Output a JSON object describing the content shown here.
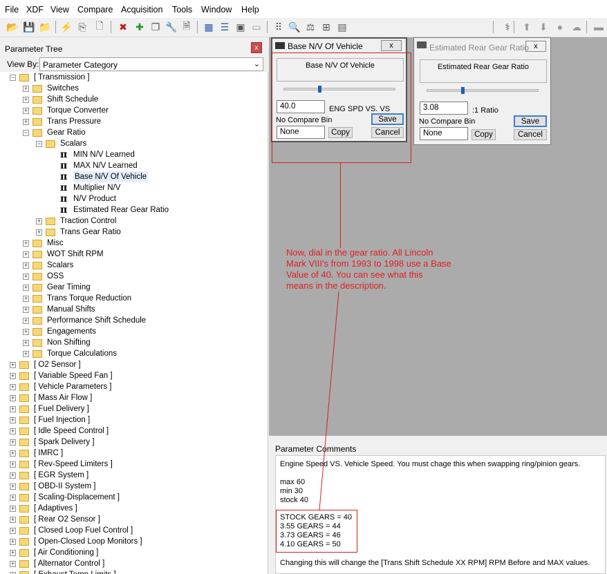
{
  "menu": [
    "File",
    "XDF",
    "View",
    "Compare",
    "Acquisition",
    "Tools",
    "Window",
    "Help"
  ],
  "toolbar": {
    "icons": [
      "open-icon",
      "save-icon",
      "open-folder-icon",
      "flash-icon",
      "copy-icon",
      "new-icon",
      "delete-icon",
      "add-icon",
      "duplicate-icon",
      "wrench-icon",
      "document-icon",
      "table-view-icon",
      "list-view-icon",
      "calendar-icon",
      "monitor-icon",
      "binary-icon",
      "search-icon",
      "balance-icon",
      "hierarchy-icon",
      "calculator-icon",
      "probe-icon",
      "up-arrow-icon",
      "down-arrow-icon",
      "record-icon",
      "cloud-icon",
      "chip-icon"
    ]
  },
  "parameter_tree": {
    "title": "Parameter Tree",
    "close": "x",
    "view_by_label": "View By:",
    "view_by_value": "Parameter Category",
    "nodes": [
      {
        "label": "[ Transmission ]",
        "level": 0,
        "expanded": true,
        "icon": "folder"
      },
      {
        "label": "Switches",
        "level": 1,
        "icon": "folder"
      },
      {
        "label": "Shift Schedule",
        "level": 1,
        "icon": "folder"
      },
      {
        "label": "Torque Converter",
        "level": 1,
        "icon": "folder"
      },
      {
        "label": "Trans Pressure",
        "level": 1,
        "icon": "folder"
      },
      {
        "label": "Gear Ratio",
        "level": 1,
        "expanded": true,
        "icon": "folder"
      },
      {
        "label": "Scalars",
        "level": 2,
        "expanded": true,
        "icon": "folder"
      },
      {
        "label": "MIN N/V Learned",
        "level": 3,
        "icon": "pi"
      },
      {
        "label": "MAX N/V Learned",
        "level": 3,
        "icon": "pi"
      },
      {
        "label": "Base N/V Of Vehicle",
        "level": 3,
        "icon": "pi",
        "selected": true
      },
      {
        "label": "Multiplier N/V",
        "level": 3,
        "icon": "pi"
      },
      {
        "label": "N/V Product",
        "level": 3,
        "icon": "pi"
      },
      {
        "label": "Estimated Rear Gear Ratio",
        "level": 3,
        "icon": "pi"
      },
      {
        "label": "Traction Control",
        "level": 2,
        "icon": "folder"
      },
      {
        "label": "Trans Gear Ratio",
        "level": 2,
        "icon": "folder"
      },
      {
        "label": "Misc",
        "level": 1,
        "icon": "folder"
      },
      {
        "label": "WOT Shift RPM",
        "level": 1,
        "icon": "folder"
      },
      {
        "label": "Scalars",
        "level": 1,
        "icon": "folder"
      },
      {
        "label": "OSS",
        "level": 1,
        "icon": "folder"
      },
      {
        "label": "Gear Timing",
        "level": 1,
        "icon": "folder"
      },
      {
        "label": "Trans Torque Reduction",
        "level": 1,
        "icon": "folder"
      },
      {
        "label": "Manual Shifts",
        "level": 1,
        "icon": "folder"
      },
      {
        "label": "Performance Shift Schedule",
        "level": 1,
        "icon": "folder"
      },
      {
        "label": "Engagements",
        "level": 1,
        "icon": "folder"
      },
      {
        "label": "Non Shifting",
        "level": 1,
        "icon": "folder"
      },
      {
        "label": "Torque Calculations",
        "level": 1,
        "icon": "folder"
      },
      {
        "label": "[ O2 Sensor ]",
        "level": 0,
        "icon": "folder"
      },
      {
        "label": "[ Variable Speed Fan ]",
        "level": 0,
        "icon": "folder"
      },
      {
        "label": "[ Vehicle Parameters ]",
        "level": 0,
        "icon": "folder"
      },
      {
        "label": "[ Mass Air Flow ]",
        "level": 0,
        "icon": "folder"
      },
      {
        "label": "[ Fuel Delivery ]",
        "level": 0,
        "icon": "folder"
      },
      {
        "label": "[ Fuel Injection ]",
        "level": 0,
        "icon": "folder"
      },
      {
        "label": "[ Idle Speed Control ]",
        "level": 0,
        "icon": "folder"
      },
      {
        "label": "[ Spark Delivery ]",
        "level": 0,
        "icon": "folder"
      },
      {
        "label": "[ IMRC ]",
        "level": 0,
        "icon": "folder"
      },
      {
        "label": "[ Rev-Speed Limiters ]",
        "level": 0,
        "icon": "folder"
      },
      {
        "label": "[ EGR System ]",
        "level": 0,
        "icon": "folder"
      },
      {
        "label": "[ OBD-II System ]",
        "level": 0,
        "icon": "folder"
      },
      {
        "label": "[ Scaling-Displacement ]",
        "level": 0,
        "icon": "folder"
      },
      {
        "label": "[ Adaptives ]",
        "level": 0,
        "icon": "folder"
      },
      {
        "label": "[ Rear O2 Sensor ]",
        "level": 0,
        "icon": "folder"
      },
      {
        "label": "[ Closed Loop Fuel Control ]",
        "level": 0,
        "icon": "folder"
      },
      {
        "label": "[ Open-Closed Loop Monitors ]",
        "level": 0,
        "icon": "folder"
      },
      {
        "label": "[ Air Conditioning ]",
        "level": 0,
        "icon": "folder"
      },
      {
        "label": "[ Alternator Control ]",
        "level": 0,
        "icon": "folder"
      },
      {
        "label": "[ Exhaust Temp Limits ]",
        "level": 0,
        "icon": "folder"
      }
    ]
  },
  "window_base": {
    "title": "Base N/V Of Vehicle",
    "description": "Base N/V Of Vehicle",
    "value": "40.0",
    "unit": "ENG SPD VS. VS",
    "compare_label": "No Compare Bin",
    "compare_value": "None",
    "save": "Save",
    "copy": "Copy",
    "cancel": "Cancel",
    "close": "x"
  },
  "window_rear": {
    "title": "Estimated Rear Gear Ratio",
    "description": "Estimated Rear Gear Ratio",
    "value": "3.08",
    "unit": ":1 Ratio",
    "compare_label": "No Compare Bin",
    "compare_value": "None",
    "save": "Save",
    "copy": "Copy",
    "cancel": "Cancel",
    "close": "x"
  },
  "annotation": "Now, dial in the gear ratio. All Lincoln Mark VIII's from 1993 to 1998 use a Base Value of 40. You can see what this means in the description.",
  "comments": {
    "heading": "Parameter Comments",
    "lines": [
      "Engine Speed VS. Vehicle Speed. You must chage this when swapping ring/pinion gears.",
      "",
      "max 60",
      "min 30",
      "stock 40",
      "",
      "STOCK GEARS = 40",
      "3.55 GEARS = 44",
      "3.73 GEARS = 46",
      "4.10 GEARS = 50",
      "",
      "Changing this will change the [Trans Shift Schedule XX RPM] RPM Before and MAX values."
    ]
  },
  "colors": {
    "annotation": "#e02020",
    "accent": "#3c7fd1"
  }
}
